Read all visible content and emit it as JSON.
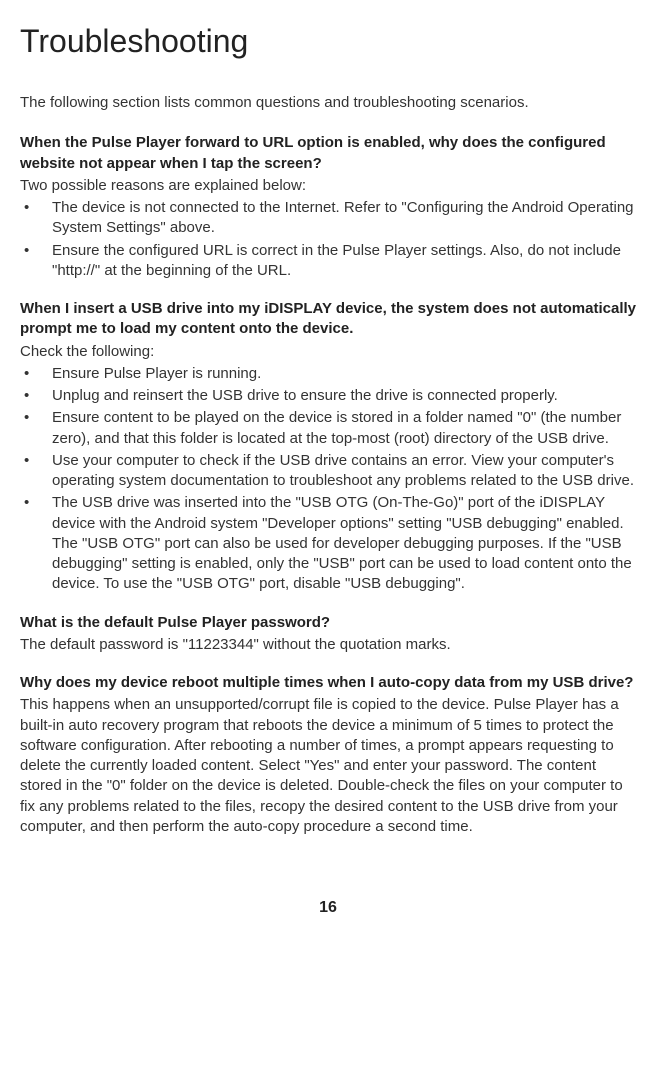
{
  "title": "Troubleshooting",
  "intro": "The following section lists common questions and troubleshooting scenarios.",
  "sections": [
    {
      "question": "When the Pulse Player forward to URL option is enabled, why does the configured website not appear when I tap the screen?",
      "answer": "Two possible reasons are explained below:",
      "bullets": [
        "The device is not connected to the Internet. Refer to \"Configuring the Android Operating System Settings\" above.",
        "Ensure the configured URL is correct in the Pulse Player settings. Also, do not include \"http://\" at the beginning of the URL."
      ]
    },
    {
      "question": "When I insert a USB drive into my iDISPLAY device, the system does not automatically prompt me to load my content onto the device.",
      "answer": "Check the following:",
      "bullets": [
        "Ensure Pulse Player is running.",
        "Unplug and reinsert the USB drive to ensure the drive is connected properly.",
        "Ensure content to be played on the device is stored in a folder named \"0\" (the number zero), and that this folder is located at the top-most (root) directory of the USB drive.",
        "Use your computer to check if the USB drive contains an error. View your computer's operating system documentation to troubleshoot any problems related to the USB drive.",
        "The USB drive was inserted into the \"USB OTG (On-The-Go)\" port of the iDISPLAY device with the Android system \"Developer options\" setting \"USB debugging\" enabled. The \"USB OTG\" port can also be used for developer debugging purposes. If the \"USB debugging\" setting is enabled, only the \"USB\" port can be used to load content onto the device. To use the \"USB OTG\" port, disable \"USB debugging\"."
      ]
    },
    {
      "question": "What is the default Pulse Player password?",
      "answer": "The default password is \"11223344\" without the quotation marks.",
      "bullets": []
    },
    {
      "question": "Why does my device reboot multiple times when I auto-copy data from my USB drive?",
      "answer": "This happens when an unsupported/corrupt file is copied to the device. Pulse Player has a built-in auto recovery program that reboots the device a minimum of 5 times to protect the software configuration. After rebooting a number of times, a prompt appears requesting to delete the currently loaded content. Select \"Yes\" and enter your password. The content stored in the \"0\" folder on the device is deleted. Double-check the files on your computer to fix any problems related to the files, recopy the desired content to the USB drive from your computer, and then perform the auto-copy procedure a second time.",
      "bullets": []
    }
  ],
  "page_number": "16"
}
